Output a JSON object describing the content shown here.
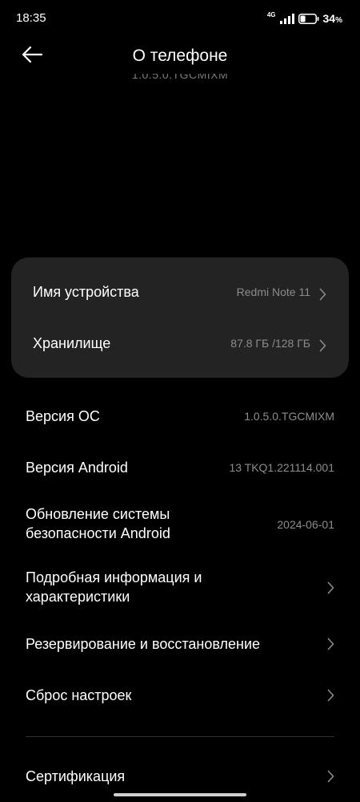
{
  "status_bar": {
    "time": "18:35",
    "network": "4G",
    "battery_percent": "34",
    "battery_unit": "%",
    "battery_level": 0.34
  },
  "header": {
    "title": "О телефоне"
  },
  "scrolled_fragment": "1.0.5.0.TGCMIXM",
  "card": {
    "device_name_label": "Имя устройства",
    "device_name_value": "Redmi Note 11",
    "storage_label": "Хранилище",
    "storage_value": "87.8 ГБ /128 ГБ"
  },
  "list": {
    "os_version_label": "Версия ОС",
    "os_version_value": "1.0.5.0.TGCMIXM",
    "android_version_label": "Версия Android",
    "android_version_value": "13 TKQ1.221114.001",
    "security_update_label_line1": "Обновление системы",
    "security_update_label_line2": "безопасности Android",
    "security_update_value": "2024-06-01",
    "detailed_info_label_line1": "Подробная информация и",
    "detailed_info_label_line2": "характеристики",
    "backup_label": "Резервирование и восстановление",
    "reset_label": "Сброс настроек",
    "certification_label": "Сертификация"
  }
}
